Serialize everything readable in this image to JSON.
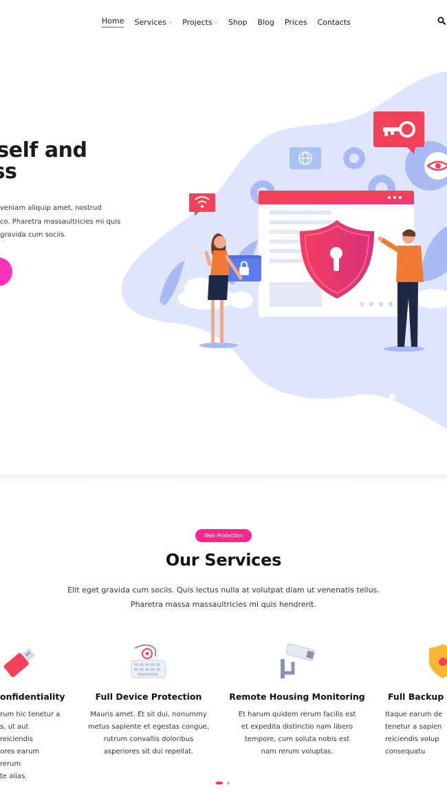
{
  "nav": {
    "items": [
      {
        "label": "Home",
        "active": true,
        "has_dropdown": false
      },
      {
        "label": "Services",
        "active": false,
        "has_dropdown": true
      },
      {
        "label": "Projects",
        "active": false,
        "has_dropdown": true
      },
      {
        "label": "Shop",
        "active": false,
        "has_dropdown": false
      },
      {
        "label": "Blog",
        "active": false,
        "has_dropdown": false
      },
      {
        "label": "Prices",
        "active": false,
        "has_dropdown": false
      },
      {
        "label": "Contacts",
        "active": false,
        "has_dropdown": false
      }
    ],
    "search_icon": "search-icon"
  },
  "hero": {
    "title_line1": "ct yourself and",
    "title_line2": "business",
    "text": "veniam aliquip amet, nostrud\nco. Pharetra massaultricies mi quis\ngravida cum sociis."
  },
  "services": {
    "badge": "Web Protection",
    "title": "Our Services",
    "subtitle": "Elit eget gravida cum sociis. Quis lectus nulla at volutpat diam ut venenatis tellus.\nPharetra massa massaultricies mi quis hendrerit.",
    "cards": [
      {
        "icon": "usb-lock-icon",
        "title": "onfidentiality",
        "text": "rum hic tenetur a\ns, ut aut reiciendis\nores earum rerum\nte alias."
      },
      {
        "icon": "keyboard-lock-icon",
        "title": "Full Device Protection",
        "text": "Mauris amet. Et sit dui, nonummy\nmetus sapiente et egestas congue,\nrutrum convallis doloribus\nasperiores sit dui repellat."
      },
      {
        "icon": "security-camera-icon",
        "title": "Remote Housing Monitoring",
        "text": "Et harum quidem rerum facilis est\net expedita distinctio nam libero\ntempore, cum soluta nobis est\nnam rerum voluptas."
      },
      {
        "icon": "shield-bug-icon",
        "title": "Full Backup o",
        "text": "Itaque earum de\ntenetur a sapien\nreiciendis volup\nconsequatu"
      }
    ]
  },
  "colors": {
    "accent": "#f7288a",
    "blob": "#dfe6fb",
    "red": "#f5405a"
  }
}
